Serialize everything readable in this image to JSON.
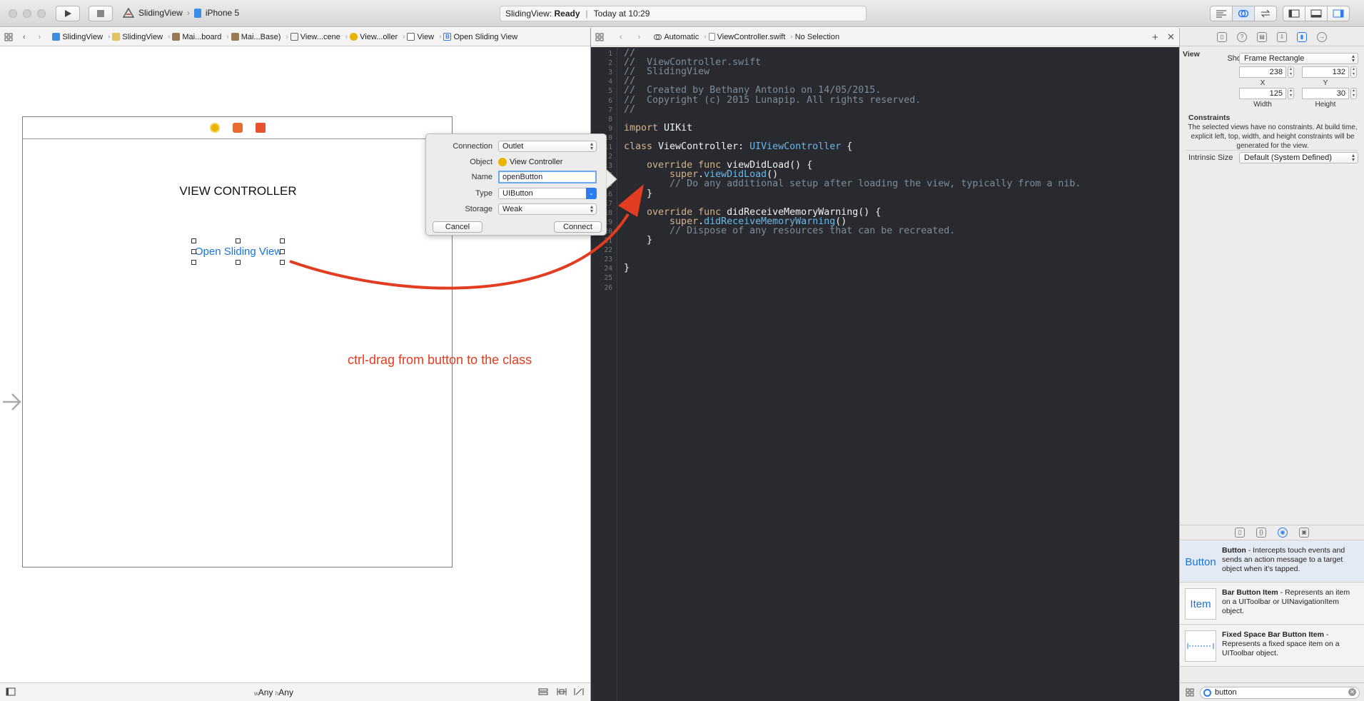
{
  "toolbar": {
    "scheme_app": "SlidingView",
    "scheme_device": "iPhone 5",
    "status_app": "SlidingView:",
    "status_state": "Ready",
    "status_time": "Today at 10:29"
  },
  "left_jumpbar": {
    "items": [
      "SlidingView",
      "SlidingView",
      "Mai...board",
      "Mai...Base)",
      "View...cene",
      "View...oller",
      "View",
      "Open Sliding View"
    ]
  },
  "right_jumpbar": {
    "mode": "Automatic",
    "file": "ViewController.swift",
    "selection": "No Selection"
  },
  "canvas": {
    "scene_title": "VIEW CONTROLLER",
    "button_label": "Open Sliding View",
    "drag_hint": "ctrl-drag from button to the class",
    "size_class_w_prefix": "w",
    "size_class_w": "Any",
    "size_class_h_prefix": "h",
    "size_class_h": "Any"
  },
  "popover": {
    "connection_label": "Connection",
    "connection_value": "Outlet",
    "object_label": "Object",
    "object_value": "View Controller",
    "name_label": "Name",
    "name_value": "openButton",
    "type_label": "Type",
    "type_value": "UIButton",
    "storage_label": "Storage",
    "storage_value": "Weak",
    "cancel": "Cancel",
    "connect": "Connect"
  },
  "editor": {
    "line_numbers": [
      "1",
      "2",
      "3",
      "4",
      "5",
      "6",
      "7",
      "8",
      "9",
      "10",
      "11",
      "12",
      "13",
      "14",
      "15",
      "16",
      "17",
      "18",
      "19",
      "20",
      "21",
      "22",
      "23",
      "24",
      "25",
      "26"
    ]
  },
  "inspector": {
    "section": "View",
    "show_label": "Show",
    "show_value": "Frame Rectangle",
    "x_value": "238",
    "y_value": "132",
    "x_caption": "X",
    "y_caption": "Y",
    "width_value": "125",
    "height_value": "30",
    "width_caption": "Width",
    "height_caption": "Height",
    "constraints_title": "Constraints",
    "constraints_desc": "The selected views have no constraints. At build time, explicit left, top, width, and height constraints will be generated for the view.",
    "intrinsic_label": "Intrinsic Size",
    "intrinsic_value": "Default (System Defined)"
  },
  "library": {
    "items": [
      {
        "thumb": "Button",
        "name": "Button",
        "desc": " - Intercepts touch events and sends an action message to a target object when it's tapped."
      },
      {
        "thumb": "Item",
        "name": "Bar Button Item",
        "desc": " - Represents an item on a UIToolbar or UINavigationItem object."
      },
      {
        "thumb": "",
        "name": "Fixed Space Bar Button Item",
        "desc": " - Represents a fixed space item on a UIToolbar object."
      }
    ],
    "search_value": "button"
  }
}
